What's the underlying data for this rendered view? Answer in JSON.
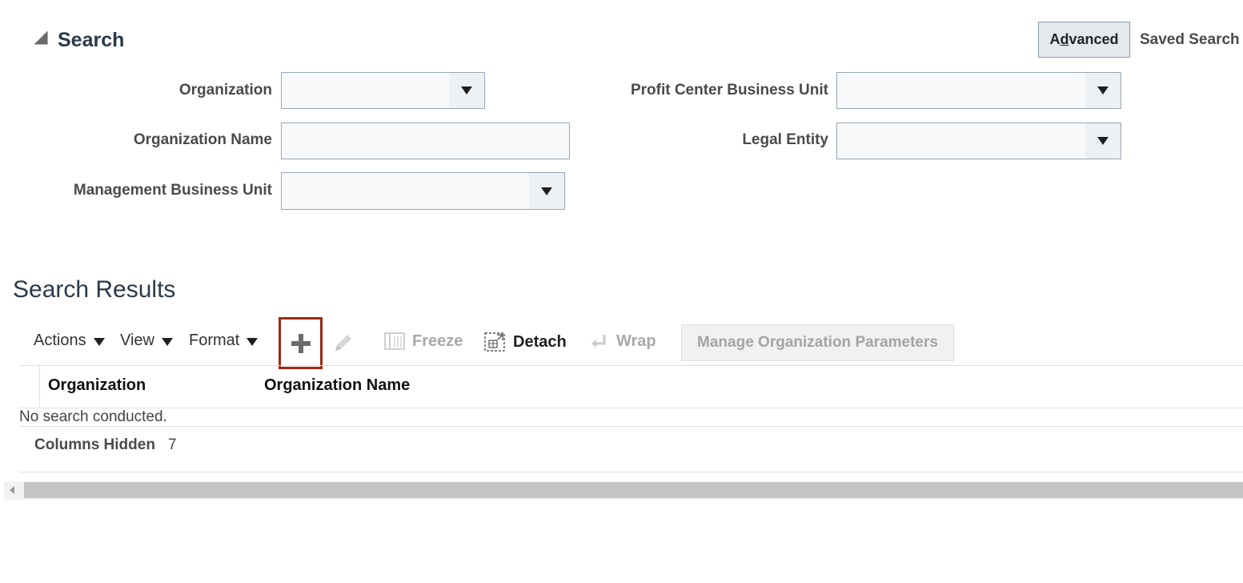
{
  "search": {
    "title": "Search",
    "advanced_label_pre": "A",
    "advanced_label_mnemonic": "d",
    "advanced_label_post": "vanced",
    "saved_search_label": "Saved Search",
    "fields": {
      "organization": {
        "label": "Organization",
        "value": ""
      },
      "organization_name": {
        "label": "Organization Name",
        "value": ""
      },
      "management_bu": {
        "label": "Management Business Unit",
        "value": ""
      },
      "profit_center_bu": {
        "label": "Profit Center Business Unit",
        "value": ""
      },
      "legal_entity": {
        "label": "Legal Entity",
        "value": ""
      }
    }
  },
  "results": {
    "title": "Search Results",
    "toolbar": {
      "actions": "Actions",
      "view": "View",
      "format": "Format",
      "add_icon": "plus-icon",
      "edit_icon": "pencil-icon",
      "freeze": "Freeze",
      "detach": "Detach",
      "wrap": "Wrap",
      "manage": "Manage Organization Parameters"
    },
    "columns": [
      "Organization",
      "Organization Name"
    ],
    "empty_message": "No search conducted.",
    "columns_hidden_label": "Columns Hidden",
    "columns_hidden_count": "7"
  },
  "colors": {
    "highlight_border": "#9b2a12",
    "title": "#2b3a4a"
  }
}
